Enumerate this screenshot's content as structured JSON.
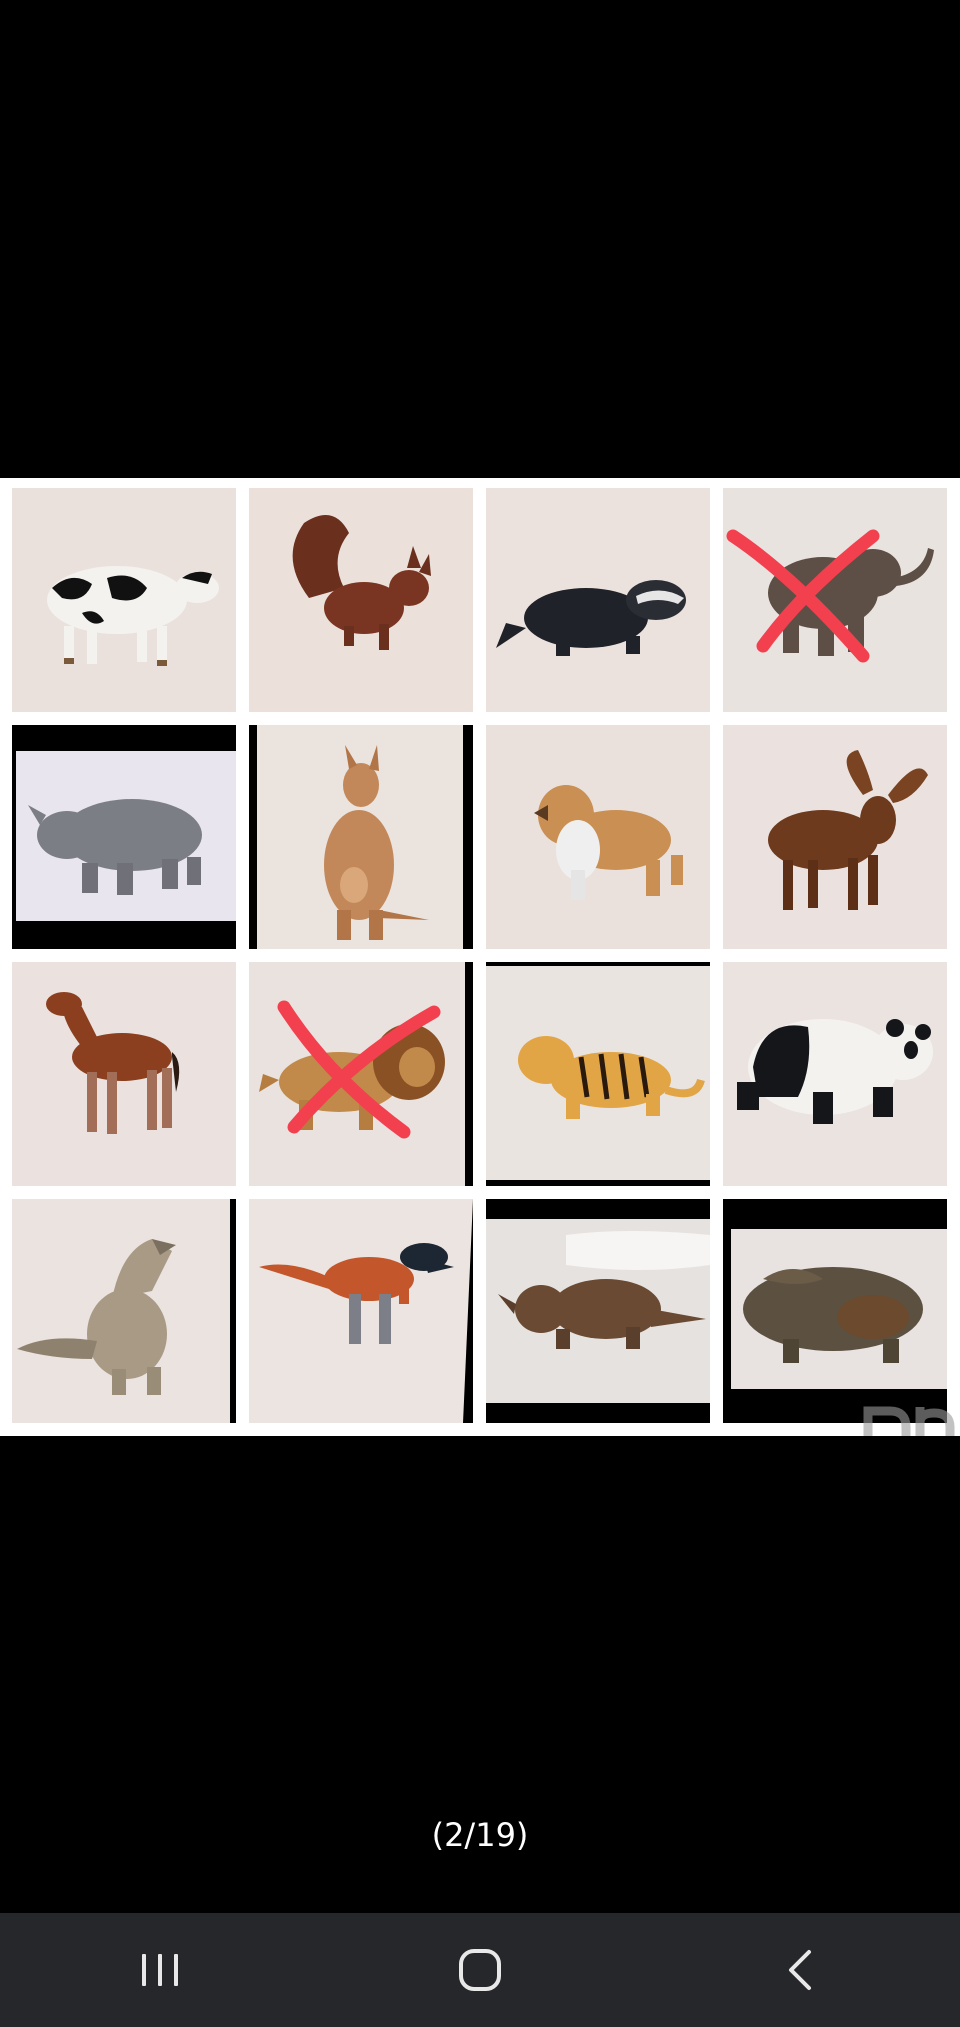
{
  "viewer": {
    "counter": "(2/19)",
    "watermark_text": "Dh"
  },
  "collage": {
    "tiles": [
      {
        "name": "cow",
        "crossed": false
      },
      {
        "name": "squirrel",
        "crossed": false
      },
      {
        "name": "badger",
        "crossed": false
      },
      {
        "name": "elephant",
        "crossed": true
      },
      {
        "name": "rhino",
        "crossed": false
      },
      {
        "name": "kangaroo",
        "crossed": false
      },
      {
        "name": "collie",
        "crossed": false
      },
      {
        "name": "moose",
        "crossed": false
      },
      {
        "name": "foal",
        "crossed": false
      },
      {
        "name": "lion",
        "crossed": true
      },
      {
        "name": "tiger",
        "crossed": false
      },
      {
        "name": "panda",
        "crossed": false
      },
      {
        "name": "wolf",
        "crossed": false
      },
      {
        "name": "raptor",
        "crossed": false
      },
      {
        "name": "triceratops",
        "crossed": false
      },
      {
        "name": "dinosaur",
        "crossed": false
      }
    ]
  },
  "navbar": {
    "recents_icon": "recents-icon",
    "home_icon": "home-icon",
    "back_icon": "back-icon"
  },
  "colors": {
    "background": "#000000",
    "collage_border": "#ffffff",
    "tile_backdrop": "#e7ddd8",
    "cross_mark": "#f2404f",
    "navbar": "#26272b",
    "nav_icon": "#e8e8e8"
  }
}
